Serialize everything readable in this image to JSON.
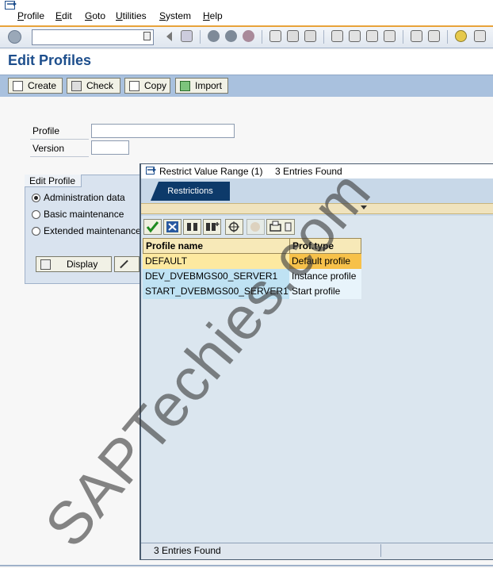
{
  "menu": {
    "items": [
      "Profile",
      "Edit",
      "Goto",
      "Utilities",
      "System",
      "Help"
    ]
  },
  "page": {
    "title": "Edit Profiles"
  },
  "app_toolbar": {
    "buttons": [
      "Create",
      "Check",
      "Copy",
      "Import"
    ]
  },
  "form": {
    "profile_label": "Profile",
    "profile_value": "",
    "version_label": "Version",
    "version_value": ""
  },
  "edit_profile": {
    "title": "Edit Profile",
    "options": [
      "Administration data",
      "Basic maintenance",
      "Extended maintenance"
    ],
    "selected": "Administration data",
    "display_button": "Display"
  },
  "popup": {
    "title": "Restrict Value Range (1)",
    "count_text": "3 Entries Found",
    "tab": "Restrictions",
    "columns": [
      "Profile name",
      "Prof.type"
    ],
    "rows": [
      [
        "DEFAULT",
        "Default profile"
      ],
      [
        "DEV_DVEBMGS00_SERVER1",
        "Instance profile"
      ],
      [
        "START_DVEBMGS00_SERVER1",
        "Start profile"
      ]
    ],
    "status": "3 Entries Found"
  },
  "watermark": "SAPTechies.com",
  "colors": {
    "title": "#1d4e8c",
    "menu_border": "#e8a33a",
    "selected_row": "#fde9a0",
    "selected_type": "#f7c14a"
  }
}
